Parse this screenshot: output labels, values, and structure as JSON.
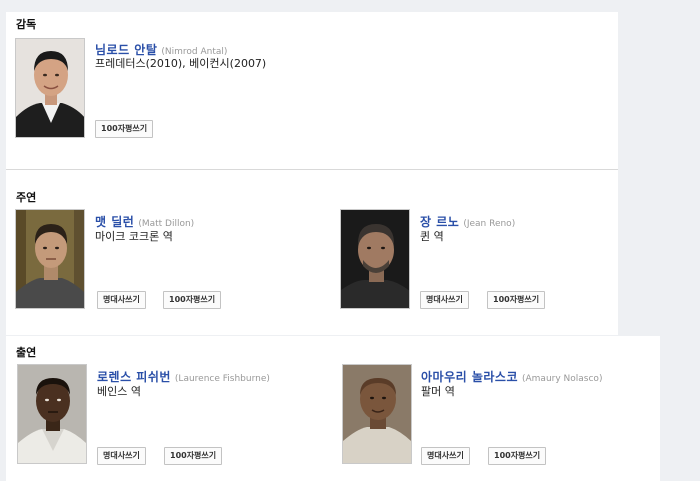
{
  "sections": {
    "director": "감독",
    "lead": "주연",
    "support": "출연"
  },
  "director": {
    "name_ko": "님로드 안탈",
    "name_en": "(Nimrod Antal)",
    "films": "프레데터스(2010), 베이컨시(2007)",
    "review_button": "100자평쓰기"
  },
  "lead": [
    {
      "name_ko": "맷 딜런",
      "name_en": "(Matt Dillon)",
      "role": "마이크 코크론 역",
      "quote_button": "명대사쓰기",
      "review_button": "100자평쓰기"
    },
    {
      "name_ko": "장 르노",
      "name_en": "(Jean Reno)",
      "role": "퀸 역",
      "quote_button": "명대사쓰기",
      "review_button": "100자평쓰기"
    }
  ],
  "support": [
    {
      "name_ko": "로렌스 피쉬번",
      "name_en": "(Laurence Fishburne)",
      "role": "베인스 역",
      "quote_button": "명대사쓰기",
      "review_button": "100자평쓰기"
    },
    {
      "name_ko": "아마우리 놀라스코",
      "name_en": "(Amaury Nolasco)",
      "role": "팔머 역",
      "quote_button": "명대사쓰기",
      "review_button": "100자평쓰기"
    }
  ],
  "colors": {
    "link": "#2a4fa8",
    "english_name": "#999999",
    "page_background": "#eef0f3"
  }
}
